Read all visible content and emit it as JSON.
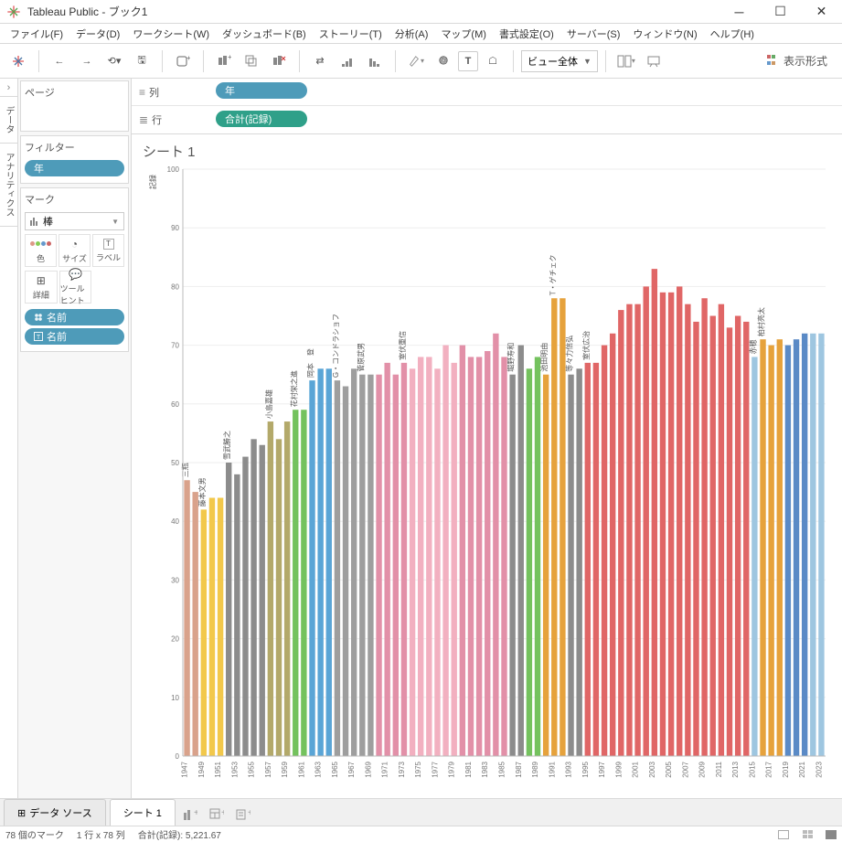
{
  "window": {
    "title": "Tableau Public - ブック1"
  },
  "menu": {
    "items": [
      {
        "label": "ファイル(F)"
      },
      {
        "label": "データ(D)"
      },
      {
        "label": "ワークシート(W)"
      },
      {
        "label": "ダッシュボード(B)"
      },
      {
        "label": "ストーリー(T)"
      },
      {
        "label": "分析(A)"
      },
      {
        "label": "マップ(M)"
      },
      {
        "label": "書式設定(O)"
      },
      {
        "label": "サーバー(S)"
      },
      {
        "label": "ウィンドウ(N)"
      },
      {
        "label": "ヘルプ(H)"
      }
    ]
  },
  "toolbar": {
    "fit_label": "ビュー全体",
    "showme_label": "表示形式"
  },
  "sidetabs": {
    "data": "データ",
    "analytics": "アナリティクス"
  },
  "pages": {
    "title": "ページ"
  },
  "filters": {
    "title": "フィルター",
    "pill": "年"
  },
  "marks": {
    "title": "マーク",
    "type": "棒",
    "cells": [
      {
        "label": "色"
      },
      {
        "label": "サイズ"
      },
      {
        "label": "ラベル"
      },
      {
        "label": "詳細"
      },
      {
        "label": "ツールヒント"
      }
    ],
    "pills": [
      {
        "label": "名前"
      },
      {
        "label": "名前"
      }
    ]
  },
  "shelves": {
    "columns": {
      "label": "列",
      "pill": "年"
    },
    "rows": {
      "label": "行",
      "pill": "合計(記録)"
    }
  },
  "viz": {
    "title": "シート 1",
    "ylabel": "記録"
  },
  "sheets": {
    "datasource": "データ ソース",
    "active": "シート 1"
  },
  "status": {
    "marks": "78 個のマーク",
    "dims": "1 行 x  78 列",
    "sum": "合計(記録): 5,221.67"
  },
  "chart_data": {
    "type": "bar",
    "title": "シート 1",
    "ylabel": "記録",
    "xlabel": "年",
    "ylim": [
      0,
      100
    ],
    "yticks": [
      0,
      10,
      20,
      30,
      40,
      50,
      60,
      70,
      80,
      90,
      100
    ],
    "series": [
      {
        "x": 1947,
        "y": 47,
        "name": "三瓶",
        "color": "#d9a28b"
      },
      {
        "x": 1948,
        "y": 45,
        "name": "三瓶",
        "color": "#d9a28b"
      },
      {
        "x": 1949,
        "y": 42,
        "name": "藤本文男",
        "color": "#f2c84b"
      },
      {
        "x": 1950,
        "y": 44,
        "name": "藤本文男",
        "color": "#f2c84b"
      },
      {
        "x": 1951,
        "y": 44,
        "name": "藤本文男",
        "color": "#f2c84b"
      },
      {
        "x": 1952,
        "y": 50,
        "name": "雪武勝之",
        "color": "#8c8c8c"
      },
      {
        "x": 1953,
        "y": 48,
        "name": "雪武勝之",
        "color": "#8c8c8c"
      },
      {
        "x": 1954,
        "y": 51,
        "name": "雪武勝之",
        "color": "#8c8c8c"
      },
      {
        "x": 1955,
        "y": 54,
        "name": "雪武勝之",
        "color": "#8c8c8c"
      },
      {
        "x": 1956,
        "y": 53,
        "name": "雪武勝之",
        "color": "#8c8c8c"
      },
      {
        "x": 1957,
        "y": 57,
        "name": "小島嘉雄",
        "color": "#b3a96a"
      },
      {
        "x": 1958,
        "y": 54,
        "name": "小島嘉雄",
        "color": "#b3a96a"
      },
      {
        "x": 1959,
        "y": 57,
        "name": "小島嘉雄",
        "color": "#b3a96a"
      },
      {
        "x": 1960,
        "y": 59,
        "name": "花村栄之進",
        "color": "#74c25e"
      },
      {
        "x": 1961,
        "y": 59,
        "name": "花村栄之進",
        "color": "#74c25e"
      },
      {
        "x": 1962,
        "y": 64,
        "name": "岡本　登",
        "color": "#5aa5d6"
      },
      {
        "x": 1963,
        "y": 66,
        "name": "岡本　登",
        "color": "#5aa5d6"
      },
      {
        "x": 1964,
        "y": 66,
        "name": "岡本　登",
        "color": "#5aa5d6"
      },
      {
        "x": 1965,
        "y": 64,
        "name": "G・コンドラショフ",
        "color": "#9e9e9e"
      },
      {
        "x": 1966,
        "y": 63,
        "name": "G・コンドラショフ",
        "color": "#9e9e9e"
      },
      {
        "x": 1967,
        "y": 66,
        "name": "G・コンドラショフ",
        "color": "#9e9e9e"
      },
      {
        "x": 1968,
        "y": 65,
        "name": "菅原武男",
        "color": "#9e9e9e"
      },
      {
        "x": 1969,
        "y": 65,
        "name": "菅原武男",
        "color": "#9e9e9e"
      },
      {
        "x": 1970,
        "y": 65,
        "name": "菅原武男",
        "color": "#e290a8"
      },
      {
        "x": 1971,
        "y": 67,
        "name": "菅原武男",
        "color": "#e290a8"
      },
      {
        "x": 1972,
        "y": 65,
        "name": "菅原武男",
        "color": "#e290a8"
      },
      {
        "x": 1973,
        "y": 67,
        "name": "室伏重信",
        "color": "#e290a8"
      },
      {
        "x": 1974,
        "y": 66,
        "name": "室伏重信",
        "color": "#f2b0c0"
      },
      {
        "x": 1975,
        "y": 68,
        "name": "室伏重信",
        "color": "#f2b0c0"
      },
      {
        "x": 1976,
        "y": 68,
        "name": "室伏重信",
        "color": "#f2b0c0"
      },
      {
        "x": 1977,
        "y": 66,
        "name": "室伏重信",
        "color": "#f2b0c0"
      },
      {
        "x": 1978,
        "y": 70,
        "name": "室伏重信",
        "color": "#f2b0c0"
      },
      {
        "x": 1979,
        "y": 67,
        "name": "室伏重信",
        "color": "#f2b0c0"
      },
      {
        "x": 1980,
        "y": 70,
        "name": "室伏重信",
        "color": "#e290a8"
      },
      {
        "x": 1981,
        "y": 68,
        "name": "室伏重信",
        "color": "#e290a8"
      },
      {
        "x": 1982,
        "y": 68,
        "name": "室伏重信",
        "color": "#e290a8"
      },
      {
        "x": 1983,
        "y": 69,
        "name": "室伏重信",
        "color": "#e290a8"
      },
      {
        "x": 1984,
        "y": 72,
        "name": "室伏重信",
        "color": "#e290a8"
      },
      {
        "x": 1985,
        "y": 68,
        "name": "室伏重信",
        "color": "#e290a8"
      },
      {
        "x": 1986,
        "y": 65,
        "name": "堀野寿和",
        "color": "#8c8c8c"
      },
      {
        "x": 1987,
        "y": 70,
        "name": "堀野寿和",
        "color": "#8c8c8c"
      },
      {
        "x": 1988,
        "y": 66,
        "name": "堀野寿和",
        "color": "#74c25e"
      },
      {
        "x": 1989,
        "y": 68,
        "name": "堀野寿和",
        "color": "#74c25e"
      },
      {
        "x": 1990,
        "y": 65,
        "name": "池田明由",
        "color": "#e6a23c"
      },
      {
        "x": 1991,
        "y": 78,
        "name": "T・ゲチェク",
        "color": "#e6a23c"
      },
      {
        "x": 1992,
        "y": 78,
        "name": "T・ゲチェク",
        "color": "#e6a23c"
      },
      {
        "x": 1993,
        "y": 65,
        "name": "等々力信弘",
        "color": "#8c8c8c"
      },
      {
        "x": 1994,
        "y": 66,
        "name": "等々力信弘",
        "color": "#8c8c8c"
      },
      {
        "x": 1995,
        "y": 67,
        "name": "室伏広治",
        "color": "#e06666"
      },
      {
        "x": 1996,
        "y": 67,
        "name": "室伏広治",
        "color": "#e06666"
      },
      {
        "x": 1997,
        "y": 70,
        "name": "室伏広治",
        "color": "#e06666"
      },
      {
        "x": 1998,
        "y": 72,
        "name": "室伏広治",
        "color": "#e06666"
      },
      {
        "x": 1999,
        "y": 76,
        "name": "室伏広治",
        "color": "#e06666"
      },
      {
        "x": 2000,
        "y": 77,
        "name": "室伏広治",
        "color": "#e06666"
      },
      {
        "x": 2001,
        "y": 77,
        "name": "室伏広治",
        "color": "#e06666"
      },
      {
        "x": 2002,
        "y": 80,
        "name": "室伏広治",
        "color": "#e06666"
      },
      {
        "x": 2003,
        "y": 83,
        "name": "室伏広治",
        "color": "#e06666"
      },
      {
        "x": 2004,
        "y": 79,
        "name": "室伏広治",
        "color": "#e06666"
      },
      {
        "x": 2005,
        "y": 79,
        "name": "室伏広治",
        "color": "#e06666"
      },
      {
        "x": 2006,
        "y": 80,
        "name": "室伏広治",
        "color": "#e06666"
      },
      {
        "x": 2007,
        "y": 77,
        "name": "室伏広治",
        "color": "#e06666"
      },
      {
        "x": 2008,
        "y": 74,
        "name": "室伏広治",
        "color": "#e06666"
      },
      {
        "x": 2009,
        "y": 78,
        "name": "室伏広治",
        "color": "#e06666"
      },
      {
        "x": 2010,
        "y": 75,
        "name": "室伏広治",
        "color": "#e06666"
      },
      {
        "x": 2011,
        "y": 77,
        "name": "室伏広治",
        "color": "#e06666"
      },
      {
        "x": 2012,
        "y": 73,
        "name": "室伏広治",
        "color": "#e06666"
      },
      {
        "x": 2013,
        "y": 75,
        "name": "室伏広治",
        "color": "#e06666"
      },
      {
        "x": 2014,
        "y": 74,
        "name": "室伏広治",
        "color": "#e06666"
      },
      {
        "x": 2015,
        "y": 68,
        "name": "赤穂",
        "color": "#9ec6e0"
      },
      {
        "x": 2016,
        "y": 71,
        "name": "柏村亮太",
        "color": "#e6a23c"
      },
      {
        "x": 2017,
        "y": 70,
        "name": "柏村亮太",
        "color": "#e6a23c"
      },
      {
        "x": 2018,
        "y": 71,
        "name": "柏村亮太",
        "color": "#e6a23c"
      },
      {
        "x": 2019,
        "y": 70,
        "name": "柏村亮太",
        "color": "#5a8ac6"
      },
      {
        "x": 2020,
        "y": 71,
        "name": "柏村亮太",
        "color": "#5a8ac6"
      },
      {
        "x": 2021,
        "y": 72,
        "name": "柏村亮太",
        "color": "#5a8ac6"
      },
      {
        "x": 2022,
        "y": 72,
        "name": "柏村亮太",
        "color": "#9ec6e0"
      },
      {
        "x": 2023,
        "y": 72,
        "name": "柏村亮太",
        "color": "#9ec6e0"
      }
    ]
  }
}
